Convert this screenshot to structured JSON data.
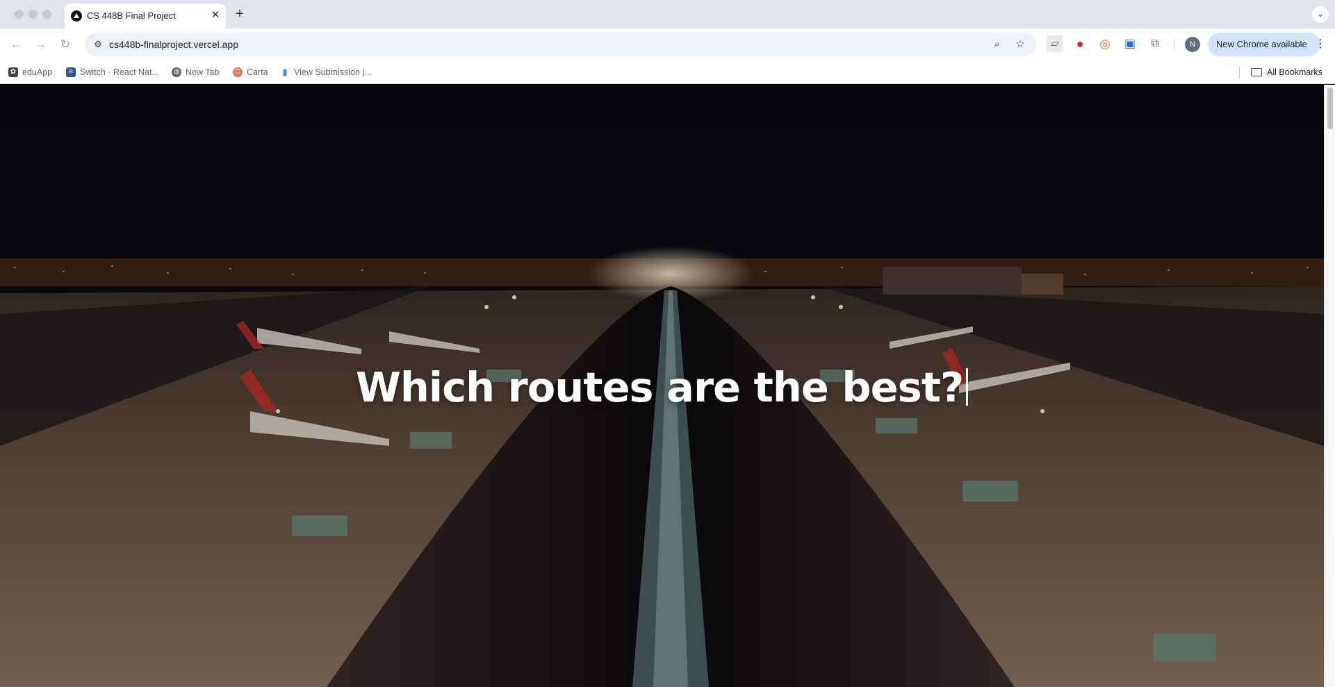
{
  "browser": {
    "tab": {
      "title": "CS 448B Final Project",
      "close_symbol": "✕"
    },
    "new_tab_symbol": "+",
    "tab_search_symbol": "⌄",
    "nav": {
      "back_symbol": "←",
      "forward_symbol": "→",
      "reload_symbol": "↻"
    },
    "omnibox": {
      "url": "cs448b-finalproject.vercel.app",
      "site_info_symbol": "⚙",
      "zoom_symbol": "⌕",
      "star_symbol": "☆"
    },
    "profile_initial": "N",
    "update_chip": {
      "label": "New Chrome available",
      "menu_symbol": "⋮"
    },
    "bookmarks": [
      {
        "label": "eduApp",
        "icon": "eduapp-icon",
        "color": "#444444"
      },
      {
        "label": "Switch · React Nat...",
        "icon": "react-icon",
        "color": "#2b5b84"
      },
      {
        "label": "New Tab",
        "icon": "globe-icon",
        "color": "#5f6368"
      },
      {
        "label": "Carta",
        "icon": "carta-icon",
        "color": "#e8715a"
      },
      {
        "label": "View Submission |...",
        "icon": "bar-chart-icon",
        "color": "#4285f4"
      }
    ],
    "all_bookmarks_label": "All Bookmarks"
  },
  "page": {
    "hero_heading": "Which routes are the best?"
  },
  "colors": {
    "tabstrip": "#dfe3ea",
    "omnibox": "#edf0f5",
    "update_chip": "#d3e3fd",
    "hero_text": "#ffffff"
  }
}
